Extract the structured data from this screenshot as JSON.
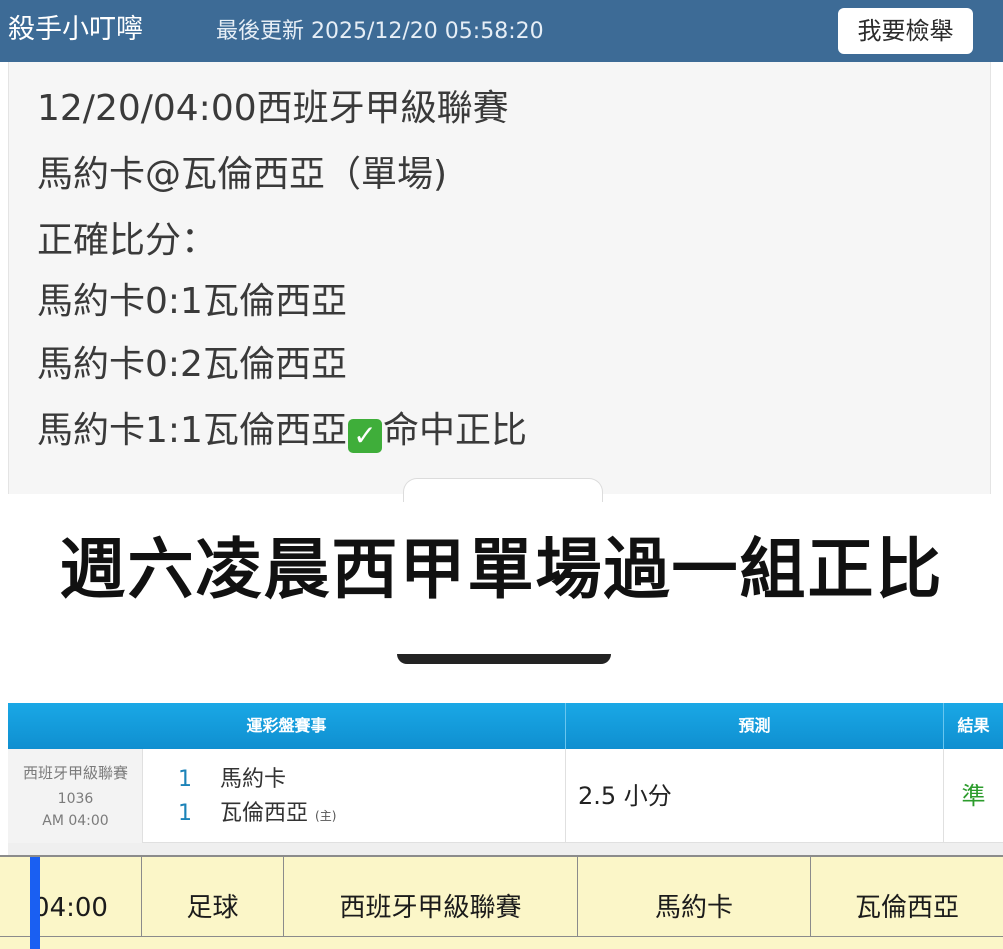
{
  "header": {
    "title": "殺手小叮嚀",
    "updated": "最後更新 2025/12/20 05:58:20",
    "report_button": "我要檢舉"
  },
  "post": {
    "lines": [
      "12/20/04:00西班牙甲級聯賽",
      "馬約卡@瓦倫西亞（單場)",
      "正確比分：",
      "馬約卡0:1瓦倫西亞",
      "馬約卡0:2瓦倫西亞"
    ],
    "hit_line_prefix": "馬約卡1:1瓦倫西亞",
    "hit_check": "✓",
    "hit_line_suffix": "命中正比"
  },
  "caption": "週六凌晨西甲單場過一組正比",
  "lottery": {
    "headers": {
      "event": "運彩盤賽事",
      "prediction": "預測",
      "result": "結果"
    },
    "row": {
      "league": "西班牙甲級聯賽",
      "code": "1036",
      "time": "AM 04:00",
      "team1_num": "1",
      "team1": "馬約卡",
      "team2_num": "1",
      "team2": "瓦倫西亞",
      "team2_tag": "(主)",
      "prediction": "2.5 小分",
      "result": "準"
    }
  },
  "schedule": {
    "time": "04:00",
    "sport": "足球",
    "league": "西班牙甲級聯賽",
    "away": "馬約卡",
    "home": "瓦倫西亞"
  },
  "colors": {
    "header_bg": "#3d6b96",
    "table_header_blue": "#1aa8e6",
    "schedule_yellow": "#fbf6c8",
    "result_green": "#2c9c2c",
    "check_green": "#3fae3a"
  }
}
